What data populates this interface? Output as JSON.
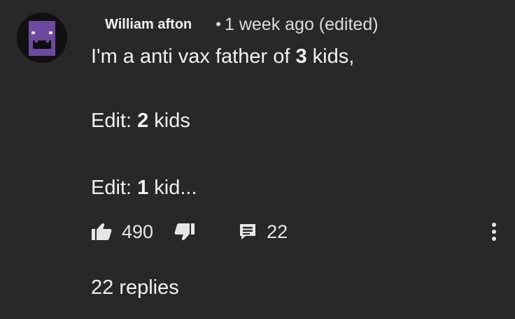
{
  "comment": {
    "author": "William afton",
    "separator": "•",
    "time": "1 week ago (edited)",
    "body": {
      "line1": {
        "before": "I'm a anti vax father of ",
        "number": "3",
        "after": " kids,"
      },
      "line2": {
        "before": "Edit: ",
        "number": "2",
        "after": " kids"
      },
      "line3": {
        "before": "Edit: ",
        "number": "1",
        "after": " kid..."
      }
    }
  },
  "actions": {
    "like_count": "490",
    "reply_count": "22",
    "icons": {
      "like": "thumbs-up-icon",
      "dislike": "thumbs-down-icon",
      "reply": "comment-icon",
      "more": "more-vertical-icon"
    }
  },
  "replies_label": "22 replies",
  "colors": {
    "background": "#282828",
    "text": "#f1f1f1",
    "avatar_purple": "#6b4aa0"
  }
}
